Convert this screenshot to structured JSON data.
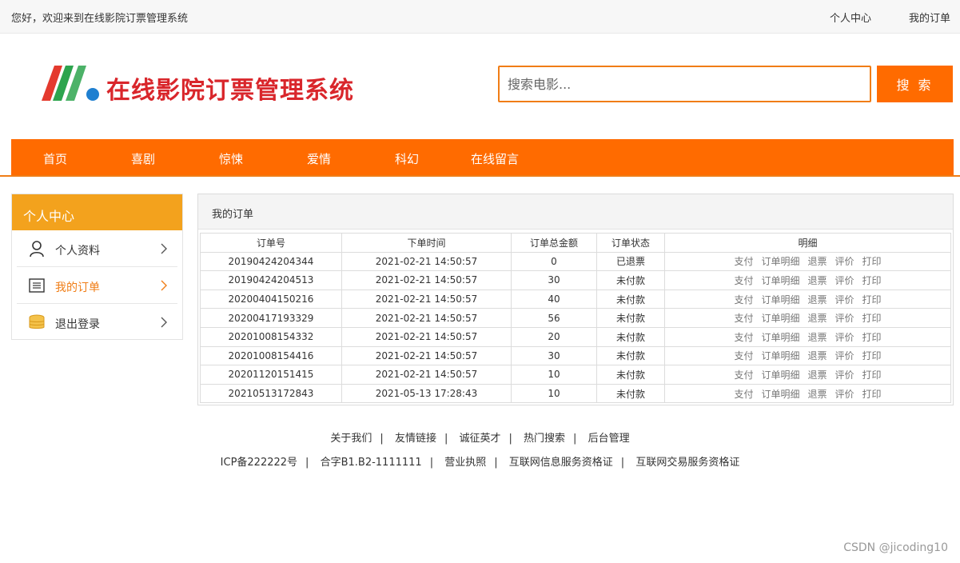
{
  "topbar": {
    "greeting": "您好，欢迎来到在线影院订票管理系统",
    "personal_center": "个人中心",
    "my_orders": "我的订单"
  },
  "header": {
    "site_title": "在线影院订票管理系统",
    "search_placeholder": "搜索电影...",
    "search_button": "搜 索"
  },
  "nav": [
    "首页",
    "喜剧",
    "惊悚",
    "爱情",
    "科幻",
    "在线留言"
  ],
  "sidebar": {
    "title": "个人中心",
    "items": [
      {
        "label": "个人资料",
        "icon": "user-icon"
      },
      {
        "label": "我的订单",
        "icon": "list-icon",
        "active": true
      },
      {
        "label": "退出登录",
        "icon": "coins-icon"
      }
    ]
  },
  "main": {
    "title": "我的订单",
    "columns": [
      "订单号",
      "下单时间",
      "订单总金额",
      "订单状态",
      "明细"
    ],
    "actions": [
      "支付",
      "订单明细",
      "退票",
      "评价",
      "打印"
    ],
    "rows": [
      {
        "id": "20190424204344",
        "time": "2021-02-21 14:50:57",
        "amount": "0",
        "status": "已退票"
      },
      {
        "id": "20190424204513",
        "time": "2021-02-21 14:50:57",
        "amount": "30",
        "status": "未付款"
      },
      {
        "id": "20200404150216",
        "time": "2021-02-21 14:50:57",
        "amount": "40",
        "status": "未付款"
      },
      {
        "id": "20200417193329",
        "time": "2021-02-21 14:50:57",
        "amount": "56",
        "status": "未付款"
      },
      {
        "id": "20201008154332",
        "time": "2021-02-21 14:50:57",
        "amount": "20",
        "status": "未付款"
      },
      {
        "id": "20201008154416",
        "time": "2021-02-21 14:50:57",
        "amount": "30",
        "status": "未付款"
      },
      {
        "id": "20201120151415",
        "time": "2021-02-21 14:50:57",
        "amount": "10",
        "status": "未付款"
      },
      {
        "id": "20210513172843",
        "time": "2021-05-13 17:28:43",
        "amount": "10",
        "status": "未付款"
      }
    ]
  },
  "footer": {
    "links": [
      "关于我们",
      "友情链接",
      "诚征英才",
      "热门搜索",
      "后台管理"
    ],
    "legal": [
      "ICP备222222号",
      "合字B1.B2-1111111",
      "营业执照",
      "互联网信息服务资格证",
      "互联网交易服务资格证"
    ]
  },
  "watermark": "CSDN @jicoding10",
  "colors": {
    "accent": "#ff6b00",
    "sidebar_head": "#f3a21d",
    "title_red": "#d9262b"
  }
}
